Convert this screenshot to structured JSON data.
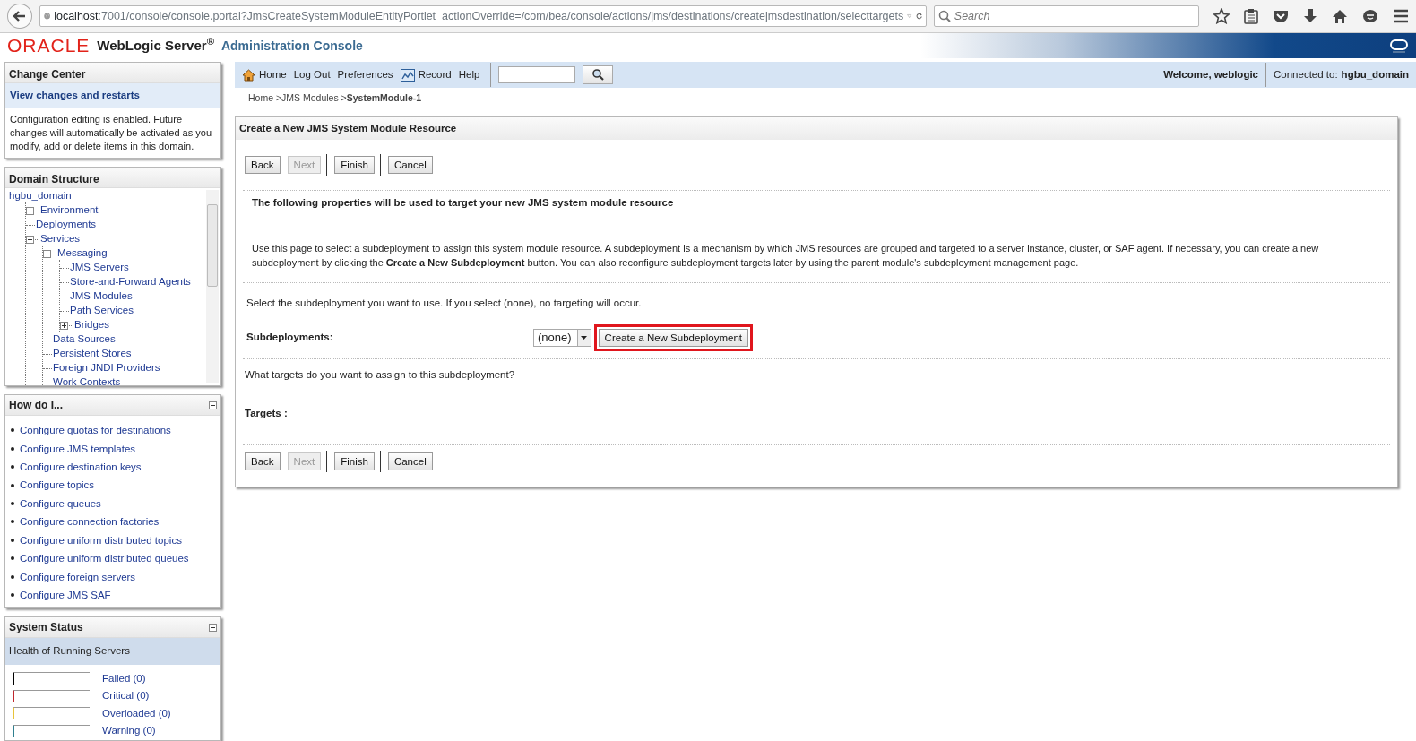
{
  "browser": {
    "url_host": "localhost",
    "url_rest": ":7001/console/console.portal?JmsCreateSystemModuleEntityPortlet_actionOverride=/com/bea/console/actions/jms/destinations/createjmsdestination/selecttargets",
    "search_placeholder": "Search"
  },
  "header": {
    "brand": "ORACLE",
    "product": "WebLogic Server$^{®}$",
    "subtitle": "Administration Console"
  },
  "change_center": {
    "title": "Change Center",
    "link": "View changes and restarts",
    "text": "Configuration editing is enabled. Future changes will automatically be activated as you modify, add or delete items in this domain."
  },
  "domain_structure": {
    "title": "Domain Structure",
    "tree": [
      {
        "label": "hgbu_domain",
        "children": [
          {
            "label": "Environment",
            "expanded": false
          },
          {
            "label": "Deployments"
          },
          {
            "label": "Services",
            "expanded": true,
            "children": [
              {
                "label": "Messaging",
                "expanded": true,
                "children": [
                  {
                    "label": "JMS Servers"
                  },
                  {
                    "label": "Store-and-Forward Agents"
                  },
                  {
                    "label": "JMS Modules"
                  },
                  {
                    "label": "Path Services"
                  },
                  {
                    "label": "Bridges",
                    "expanded": false
                  }
                ]
              },
              {
                "label": "Data Sources"
              },
              {
                "label": "Persistent Stores"
              },
              {
                "label": "Foreign JNDI Providers"
              },
              {
                "label": "Work Contexts"
              }
            ]
          }
        ]
      }
    ]
  },
  "how_do_i": {
    "title": "How do I...",
    "items": [
      "Configure quotas for destinations",
      "Configure JMS templates",
      "Configure destination keys",
      "Configure topics",
      "Configure queues",
      "Configure connection factories",
      "Configure uniform distributed topics",
      "Configure uniform distributed queues",
      "Configure foreign servers",
      "Configure JMS SAF"
    ]
  },
  "system_status": {
    "title": "System Status",
    "subtitle": "Health of Running Servers",
    "items": [
      {
        "label": "Failed (0)",
        "color": "#000000"
      },
      {
        "label": "Critical (0)",
        "color": "#c0272d"
      },
      {
        "label": "Overloaded (0)",
        "color": "#e8c33a"
      },
      {
        "label": "Warning (0)",
        "color": "#2f7f8f"
      }
    ]
  },
  "toolbar": {
    "items": [
      {
        "label": "Home"
      },
      {
        "label": "Log Out"
      },
      {
        "label": "Preferences"
      },
      {
        "label": "Record"
      },
      {
        "label": "Help"
      }
    ],
    "welcome": "Welcome, weblogic",
    "connected_label": "Connected to:",
    "domain": "hgbu_domain"
  },
  "breadcrumb": [
    {
      "label": "Home >",
      "current": false
    },
    {
      "label": "JMS Modules >",
      "current": false
    },
    {
      "label": "SystemModule-1",
      "current": true
    }
  ],
  "panel": {
    "title": "Create a New JMS System Module Resource",
    "buttons_top": [
      {
        "label": "Back",
        "disabled": false,
        "separator_before": false
      },
      {
        "label": "Next",
        "disabled": true,
        "separator_before": false
      },
      {
        "label": "Finish",
        "disabled": false,
        "separator_before": true
      },
      {
        "label": "Cancel",
        "disabled": false,
        "separator_before": true
      }
    ],
    "heading": "The following properties will be used to target your new JMS system module resource",
    "intro": "Use this page to select a subdeployment to assign this system module resource. A subdeployment is a mechanism by which JMS resources are grouped and targeted to a server instance, cluster, or SAF agent. If necessary, you can create a new subdeployment by clicking the **Create a New Subdeployment** button. You can also reconfigure subdeployment targets later by using the parent module's subdeployment management page.",
    "select_hint": "Select the subdeployment you want to use. If you select (none), no targeting will occur.",
    "subdeployments_label": "Subdeployments:",
    "subdeployment_value": "(none)",
    "create_button": {
      "label": "Create a New Subdeployment",
      "highlighted": true
    },
    "targets_question": "What targets do you want to assign to this subdeployment?",
    "targets_label": "Targets :",
    "buttons_bottom": [
      {
        "label": "Back",
        "disabled": false,
        "separator_before": false
      },
      {
        "label": "Next",
        "disabled": true,
        "separator_before": false
      },
      {
        "label": "Finish",
        "disabled": false,
        "separator_before": true
      },
      {
        "label": "Cancel",
        "disabled": false,
        "separator_before": true
      }
    ]
  }
}
